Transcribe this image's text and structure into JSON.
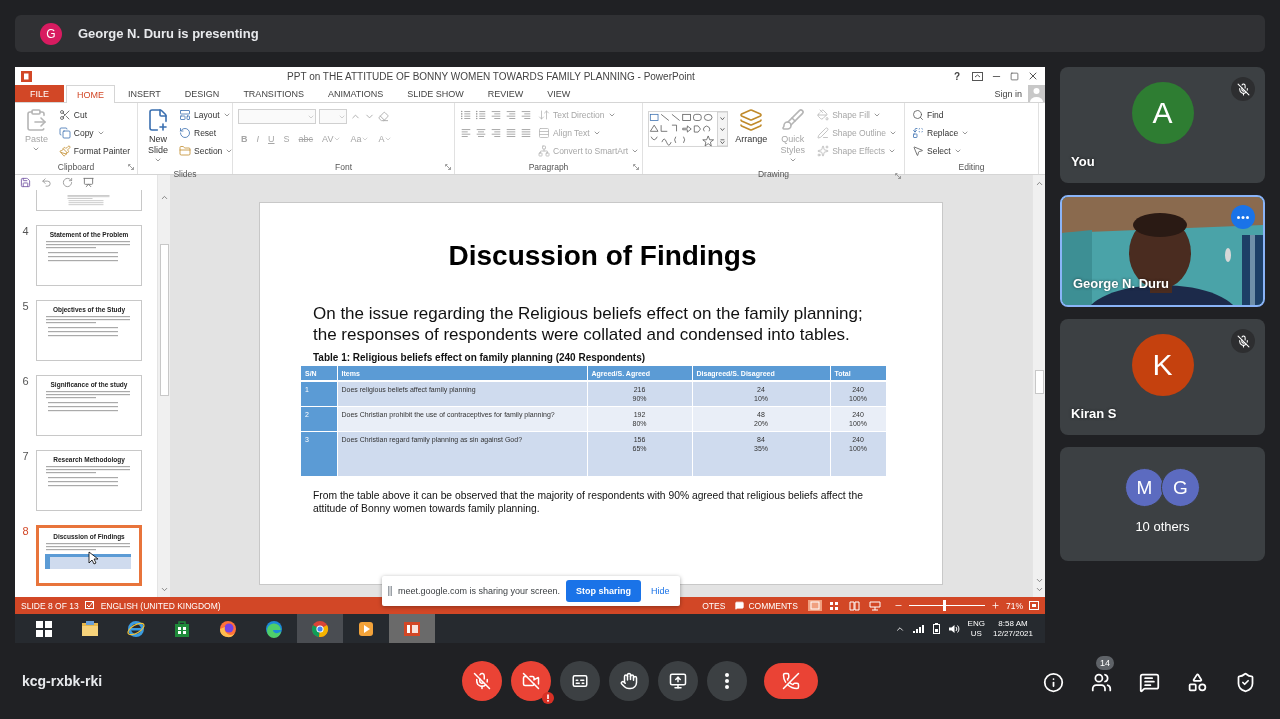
{
  "presenter": {
    "avatar": "G",
    "text": "George N. Duru is presenting"
  },
  "powerpoint": {
    "title": "PPT on THE ATTITUDE OF BONNY WOMEN TOWARDS FAMILY PLANNING - PowerPoint",
    "help": "?",
    "sign_in": "Sign in",
    "tabs": [
      {
        "label": "FILE",
        "kind": "file",
        "selected": false
      },
      {
        "label": "HOME",
        "kind": "tab",
        "selected": true
      },
      {
        "label": "INSERT",
        "kind": "tab",
        "selected": false
      },
      {
        "label": "DESIGN",
        "kind": "tab",
        "selected": false
      },
      {
        "label": "TRANSITIONS",
        "kind": "tab",
        "selected": false
      },
      {
        "label": "ANIMATIONS",
        "kind": "tab",
        "selected": false
      },
      {
        "label": "SLIDE SHOW",
        "kind": "tab",
        "selected": false
      },
      {
        "label": "REVIEW",
        "kind": "tab",
        "selected": false
      },
      {
        "label": "VIEW",
        "kind": "tab",
        "selected": false
      }
    ],
    "ribbon": [
      {
        "label": "Clipboard",
        "kind": "standard",
        "launcher": true,
        "items": [
          {
            "label": "Paste",
            "kind": "large",
            "dropdown": true,
            "disabled": true
          },
          {
            "label": "Cut",
            "kind": "small",
            "dropdown": false,
            "disabled": false
          },
          {
            "label": "Copy",
            "kind": "small",
            "dropdown": true,
            "disabled": false
          },
          {
            "label": "Format Painter",
            "kind": "small",
            "dropdown": false,
            "disabled": false
          }
        ]
      },
      {
        "label": "Slides",
        "kind": "standard",
        "launcher": false,
        "items": [
          {
            "label": "New Slide",
            "kind": "large",
            "dropdown": true,
            "disabled": false
          },
          {
            "label": "Layout",
            "kind": "small",
            "dropdown": true,
            "disabled": false
          },
          {
            "label": "Reset",
            "kind": "small",
            "dropdown": false,
            "disabled": false
          },
          {
            "label": "Section",
            "kind": "small",
            "dropdown": true,
            "disabled": false
          }
        ]
      },
      {
        "label": "Font",
        "kind": "font",
        "launcher": true,
        "disabled": true,
        "buttons": [
          {
            "label": "B",
            "dropdown": false
          },
          {
            "label": "I",
            "dropdown": false
          },
          {
            "label": "U",
            "dropdown": false
          },
          {
            "label": "S",
            "dropdown": false
          },
          {
            "label": "abc",
            "dropdown": false
          },
          {
            "label": "AV",
            "dropdown": true
          },
          {
            "label": "Aa",
            "dropdown": true
          },
          {
            "label": "A",
            "dropdown": true
          }
        ]
      },
      {
        "label": "Paragraph",
        "kind": "paragraph",
        "launcher": true,
        "items": [
          {
            "label": "Text Direction",
            "kind": "small",
            "dropdown": true,
            "disabled": true
          },
          {
            "label": "Align Text",
            "kind": "small",
            "dropdown": true,
            "disabled": true
          },
          {
            "label": "Convert to SmartArt",
            "kind": "small",
            "dropdown": true,
            "disabled": true
          }
        ]
      },
      {
        "label": "Drawing",
        "kind": "drawing",
        "launcher": true,
        "items": [
          {
            "label": "Arrange",
            "kind": "large",
            "dropdown": false,
            "disabled": false
          },
          {
            "label": "Quick Styles",
            "kind": "large",
            "dropdown": true,
            "disabled": true
          },
          {
            "label": "Shape Fill",
            "kind": "small",
            "dropdown": true,
            "disabled": true
          },
          {
            "label": "Shape Outline",
            "kind": "small",
            "dropdown": true,
            "disabled": true
          },
          {
            "label": "Shape Effects",
            "kind": "small",
            "dropdown": true,
            "disabled": true
          }
        ]
      },
      {
        "label": "Editing",
        "kind": "standard",
        "launcher": false,
        "items": [
          {
            "label": "Find",
            "kind": "small",
            "dropdown": false,
            "disabled": false
          },
          {
            "label": "Replace",
            "kind": "small",
            "dropdown": true,
            "disabled": false
          },
          {
            "label": "Select",
            "kind": "small",
            "dropdown": true,
            "disabled": false
          }
        ]
      }
    ],
    "thumbnails": [
      {
        "kind": "partial",
        "selected": false
      },
      {
        "kind": "full",
        "number": "4",
        "title": "Statement of the Problem",
        "selected": false
      },
      {
        "kind": "full",
        "number": "5",
        "title": "Objectives of the Study",
        "selected": false
      },
      {
        "kind": "full",
        "number": "6",
        "title": "Significance of the study",
        "selected": false
      },
      {
        "kind": "full",
        "number": "7",
        "title": "Research Methodology",
        "selected": false
      },
      {
        "kind": "full",
        "number": "8",
        "title": "Discussion of Findings",
        "selected": true
      }
    ],
    "slide": {
      "title": "Discussion of Findings",
      "intro": "On the issue regarding the Religious beliefs effect on the family planning; the responses of respondents were collated and condensed into tables.",
      "table": {
        "caption": "Table 1: Religious beliefs effect on family planning (240 Respondents)",
        "columns": [
          "S/N",
          "Items",
          "Agreed/S. Agreed",
          "Disagreed/S. Disagreed",
          "Total"
        ],
        "rows": [
          [
            "1",
            "Does religious beliefs affect family planning",
            "216\n90%",
            "24\n10%",
            "240\n100%"
          ],
          [
            "2",
            "Does Christian prohibit the use of contraceptives for family planning?",
            "192\n80%",
            "48\n20%",
            "240\n100%"
          ],
          [
            "3",
            "Does Christian regard family planning as sin against God?",
            "156\n65%",
            "84\n35%",
            "240\n100%"
          ]
        ]
      },
      "note": "From the table above it can be observed that the majority of respondents with 90% agreed that religious beliefs affect the attitude of Bonny women towards family planning."
    },
    "status": {
      "slide": "SLIDE 8 OF 13",
      "language": "ENGLISH (UNITED KINGDOM)",
      "notes": "OTES",
      "comments": "COMMENTS",
      "zoom": {
        "level": 0.45
      },
      "zoom_text": "71%"
    }
  },
  "share_notice": {
    "text": "meet.google.com is sharing your screen.",
    "stop": "Stop sharing",
    "hide": "Hide"
  },
  "taskbar": {
    "apps": [
      {
        "kind": "start",
        "active": false
      },
      {
        "kind": "explorer",
        "active": false
      },
      {
        "kind": "ie",
        "active": false
      },
      {
        "kind": "store",
        "active": false
      },
      {
        "kind": "firefox",
        "active": false
      },
      {
        "kind": "edge",
        "active": false
      },
      {
        "kind": "chrome",
        "active": true
      },
      {
        "kind": "media",
        "active": false
      },
      {
        "kind": "powerpoint",
        "active": true
      }
    ],
    "tray": {
      "language": "ENG",
      "region": "US",
      "time": "8:58 AM",
      "date": "12/27/2021"
    }
  },
  "participants": [
    {
      "kind": "avatar",
      "name": "You",
      "letter": "A",
      "color": "#2e7d32",
      "muted": true,
      "speaking": false
    },
    {
      "kind": "video",
      "name": "George N. Duru",
      "muted": false,
      "speaking": true
    },
    {
      "kind": "avatar",
      "name": "Kiran S",
      "letter": "K",
      "color": "#c5410e",
      "muted": true,
      "speaking": false
    },
    {
      "kind": "group",
      "label": "10 others",
      "avatars": [
        {
          "letter": "M",
          "color": "#5c6bc0"
        },
        {
          "letter": "G",
          "color": "#5c6bc0"
        }
      ]
    }
  ],
  "meeting": {
    "code": "kcg-rxbk-rki",
    "controls": [
      {
        "kind": "mic",
        "on": false
      },
      {
        "kind": "camera",
        "on": false,
        "warning": true
      },
      {
        "kind": "captions",
        "on": false
      },
      {
        "kind": "hand",
        "on": false
      },
      {
        "kind": "present",
        "on": false
      },
      {
        "kind": "more"
      },
      {
        "kind": "leave"
      }
    ],
    "side_buttons": [
      {
        "kind": "info"
      },
      {
        "kind": "people",
        "badge": "14"
      },
      {
        "kind": "chat"
      },
      {
        "kind": "activities"
      },
      {
        "kind": "security"
      }
    ]
  }
}
